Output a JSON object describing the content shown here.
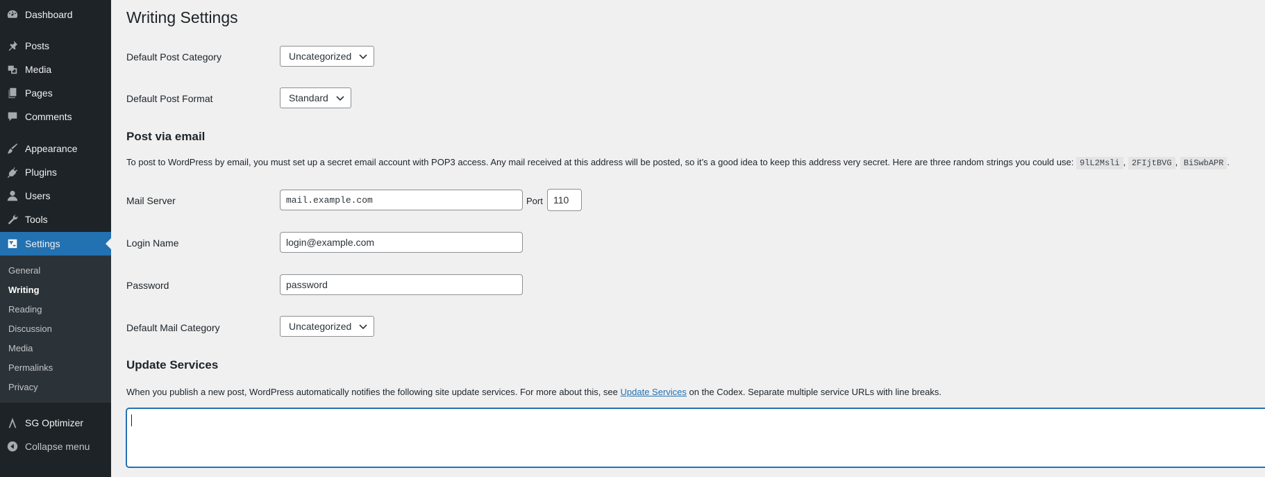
{
  "sidebar": {
    "items": [
      {
        "label": "Dashboard",
        "icon": "dashboard-icon"
      },
      {
        "label": "Posts",
        "icon": "pin-icon"
      },
      {
        "label": "Media",
        "icon": "media-icon"
      },
      {
        "label": "Pages",
        "icon": "pages-icon"
      },
      {
        "label": "Comments",
        "icon": "comment-icon"
      },
      {
        "label": "Appearance",
        "icon": "brush-icon"
      },
      {
        "label": "Plugins",
        "icon": "plug-icon"
      },
      {
        "label": "Users",
        "icon": "user-icon"
      },
      {
        "label": "Tools",
        "icon": "wrench-icon"
      },
      {
        "label": "Settings",
        "icon": "settings-icon"
      }
    ],
    "submenu": [
      "General",
      "Writing",
      "Reading",
      "Discussion",
      "Media",
      "Permalinks",
      "Privacy"
    ],
    "sg_optimizer": "SG Optimizer",
    "collapse": "Collapse menu",
    "accent_color": "#2271b1"
  },
  "page": {
    "title": "Writing Settings",
    "default_post_category": {
      "label": "Default Post Category",
      "value": "Uncategorized"
    },
    "default_post_format": {
      "label": "Default Post Format",
      "value": "Standard"
    },
    "post_via_email": {
      "heading": "Post via email",
      "desc": "To post to WordPress by email, you must set up a secret email account with POP3 access. Any mail received at this address will be posted, so it’s a good idea to keep this address very secret. Here are three random strings you could use:",
      "strings": [
        "9lL2Msli",
        "2FIjtBVG",
        "BiSwbAPR"
      ],
      "sep": ",",
      "end": "."
    },
    "mail_server": {
      "label": "Mail Server",
      "value": "mail.example.com",
      "port_label": "Port",
      "port_value": "110"
    },
    "login_name": {
      "label": "Login Name",
      "value": "login@example.com"
    },
    "password": {
      "label": "Password",
      "value": "password"
    },
    "default_mail_category": {
      "label": "Default Mail Category",
      "value": "Uncategorized"
    },
    "update_services": {
      "heading": "Update Services",
      "desc_before": "When you publish a new post, WordPress automatically notifies the following site update services. For more about this, see",
      "link": "Update Services",
      "desc_after": "on the Codex. Separate multiple service URLs with line breaks.",
      "value": ""
    }
  }
}
